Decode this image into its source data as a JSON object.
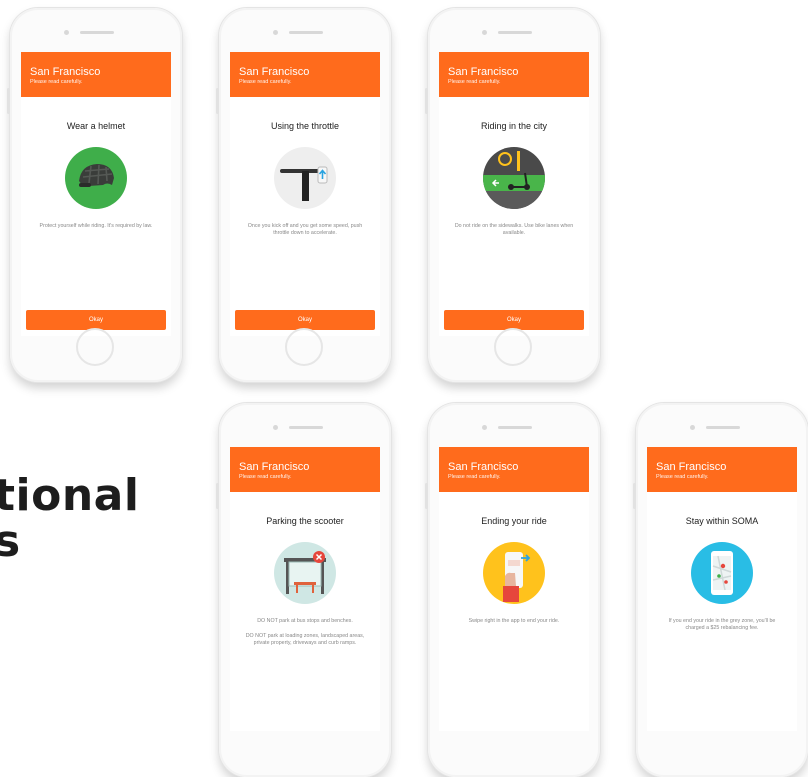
{
  "cards": [
    {
      "city": "San Francisco",
      "subtitle": "Please read carefully.",
      "title": "Wear a helmet",
      "description": "Protect yourself while riding. It's required by law.",
      "button": "Okay"
    },
    {
      "city": "San Francisco",
      "subtitle": "Please read carefully.",
      "title": "Using the throttle",
      "description": "Once you kick off and you get some speed, push throttle down to accelerate.",
      "button": "Okay"
    },
    {
      "city": "San Francisco",
      "subtitle": "Please read carefully.",
      "title": "Riding in the city",
      "description": "Do not ride on the sidewalks. Use bike lanes when available.",
      "button": "Okay"
    },
    {
      "city": "San Francisco",
      "subtitle": "Please read carefully.",
      "title": "Parking the scooter",
      "description": "DO NOT park at bus stops and benches.",
      "description2": "DO NOT park at loading zones, landscaped areas, private property, driveways and curb ramps."
    },
    {
      "city": "San Francisco",
      "subtitle": "Please read carefully.",
      "title": "Ending your ride",
      "description": "Swipe right in the app to end your ride."
    },
    {
      "city": "San Francisco",
      "subtitle": "Please read carefully.",
      "title": "Stay within SOMA",
      "description": "If you end your ride in the grey zone, you'll be charged a $25 rebalancing fee."
    }
  ],
  "headline": {
    "line1": "tional",
    "line2": "s"
  },
  "colors": {
    "accent": "#ff6b1c",
    "helmet_bg": "#3fae4a",
    "throttle_bg": "#eeeeee",
    "city_bg": "#4a4a4a",
    "parking_bg": "#cfe7e4",
    "ride_bg": "#ffc21c",
    "soma_bg": "#29bde5"
  },
  "icons": [
    "helmet-icon",
    "throttle-icon",
    "city-lane-icon",
    "bus-stop-icon",
    "swipe-phone-icon",
    "map-phone-icon"
  ]
}
